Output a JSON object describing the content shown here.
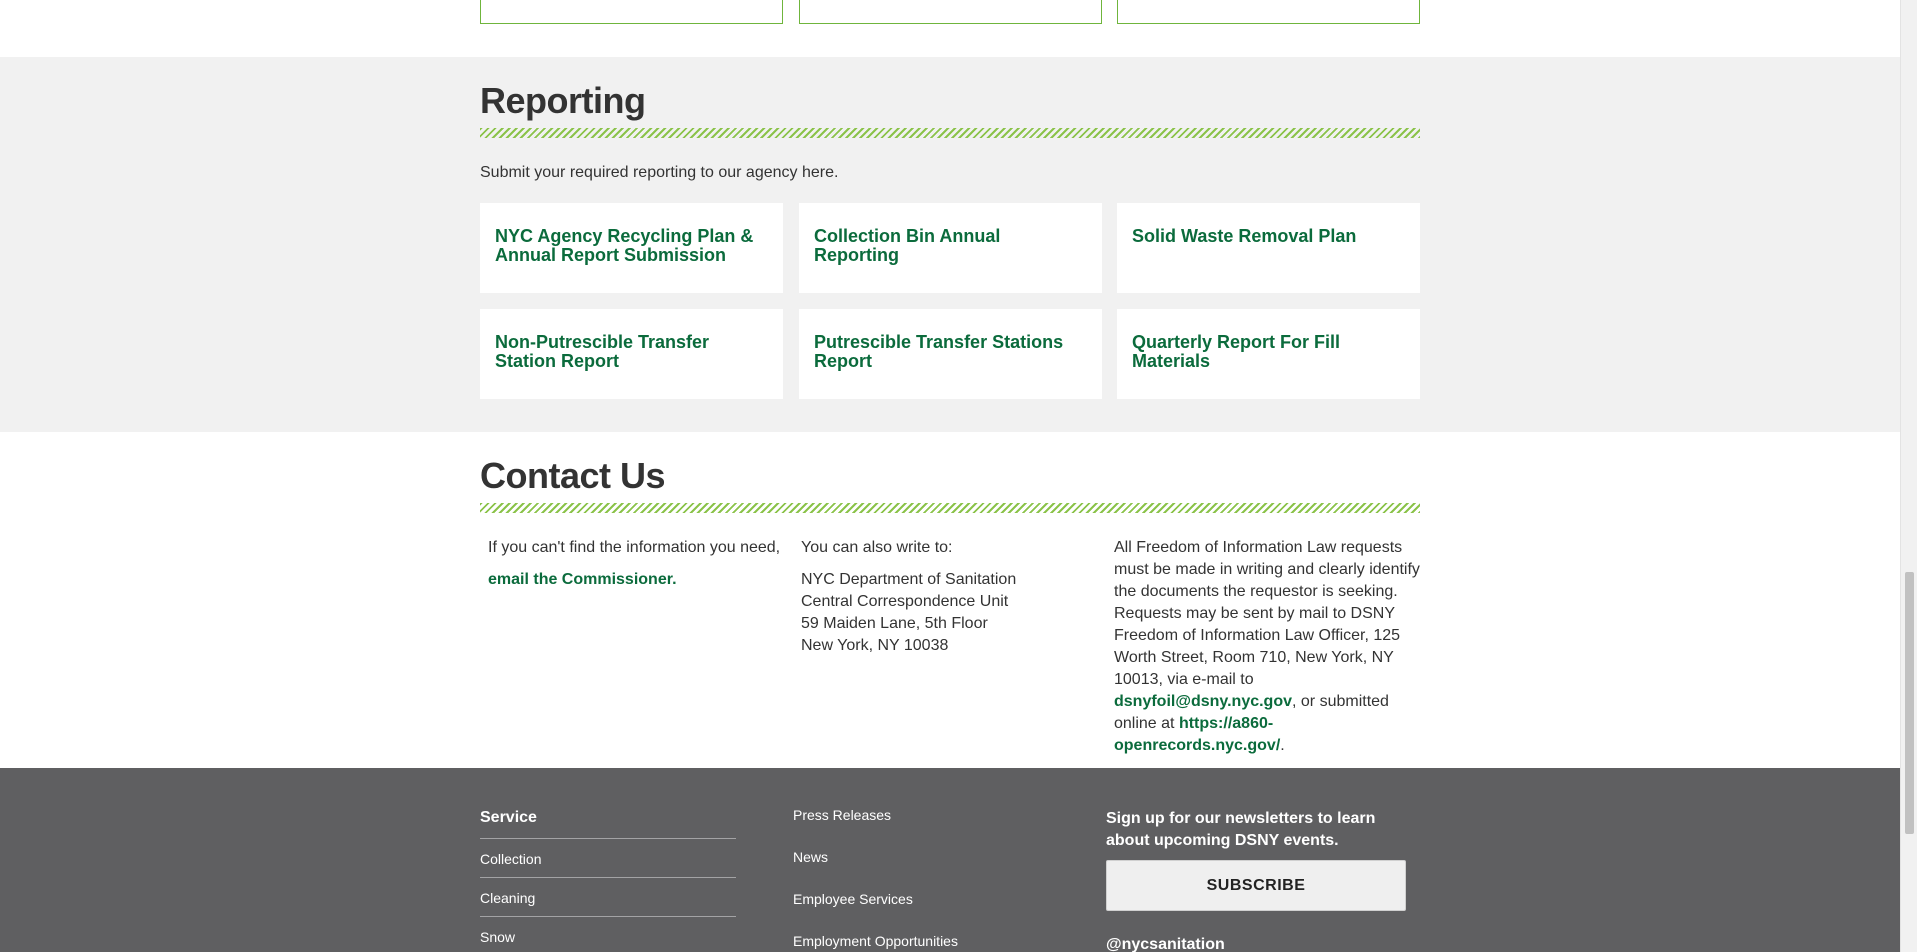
{
  "reporting": {
    "title": "Reporting",
    "intro": "Submit your required reporting to our agency here.",
    "cards": [
      {
        "label": "NYC Agency Recycling Plan & Annual Report Submission"
      },
      {
        "label": "Collection Bin Annual Reporting"
      },
      {
        "label": "Solid Waste Removal Plan"
      },
      {
        "label": "Non-Putrescible Transfer Station Report"
      },
      {
        "label": "Putrescible Transfer Stations Report"
      },
      {
        "label": "Quarterly Report For Fill Materials"
      }
    ]
  },
  "contact": {
    "title": "Contact Us",
    "col1_text": "If you can't find the information you need,",
    "col1_link": "email the Commissioner.",
    "col2_intro": "You can also write to:",
    "col2_address": [
      "NYC Department of Sanitation",
      "Central Correspondence Unit",
      "59 Maiden Lane, 5th Floor",
      "New York, NY 10038"
    ],
    "col3_text": "All Freedom of Information Law requests must be made in writing and clearly identify the documents the requestor is seeking. Requests may be sent by mail to DSNY Freedom of Information Law Officer, 125 Worth Street, Room 710, New York, NY 10013, via e-mail to",
    "col3_email": "dsnyfoil@dsny.nyc.gov",
    "col3_mid": ", or submitted online at",
    "col3_url": "https://a860-openrecords.nyc.gov/",
    "col3_end": "."
  },
  "footer": {
    "service_heading": "Service",
    "service_items": [
      "Collection",
      "Cleaning",
      "Snow"
    ],
    "middle_links": [
      "Press Releases",
      "News",
      "Employee Services",
      "Employment Opportunities"
    ],
    "newsletter_text": "Sign up for our newsletters to learn about upcoming DSNY events.",
    "subscribe_label": "SUBSCRIBE",
    "social_handle": "@nycsanitation"
  },
  "colors": {
    "accent_green": "#0b6b3c",
    "hatch_green": "#8bc34a",
    "footer_bg": "#5f5f61",
    "section_bg": "#f1f1f1"
  }
}
